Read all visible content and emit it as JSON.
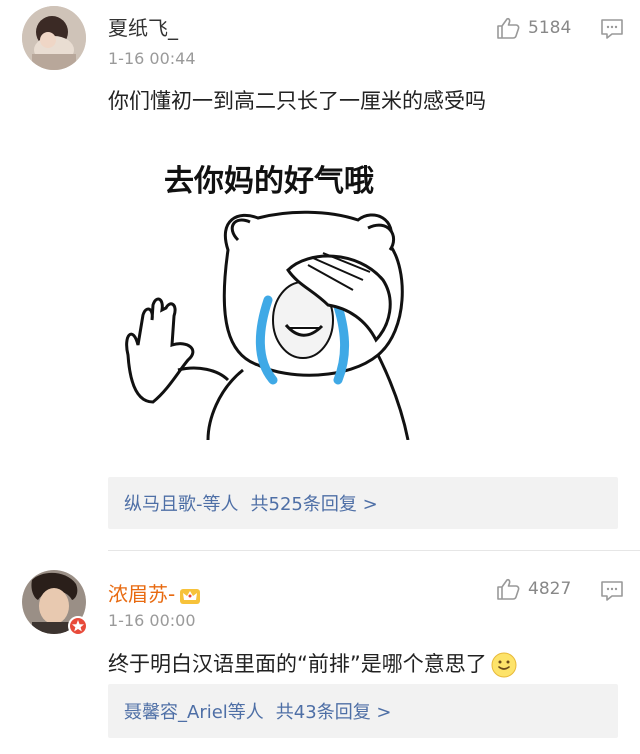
{
  "comments": [
    {
      "username": "夏纸飞_",
      "time": "1-16 00:44",
      "likes": "5184",
      "text": "你们懂初一到高二只长了一厘米的感受吗",
      "image": {
        "caption": "去你妈的好气哦"
      },
      "replies": {
        "names": "纵马且歌-等人",
        "count": "共525条回复 >"
      }
    },
    {
      "username": "浓眉苏-",
      "time": "1-16 00:00",
      "likes": "4827",
      "text": "终于明白汉语里面的“前排”是哪个意思了",
      "replies": {
        "names": "聂馨容_Ariel等人",
        "count": "共43条回复 >"
      }
    }
  ],
  "colors": {
    "link": "#4e6fa6",
    "vip_name": "#e86a10",
    "muted": "#9a9a9a",
    "tears": "#3fa9e6"
  },
  "icons": [
    "thumbs-up-icon",
    "comment-icon",
    "crown-badge-icon",
    "smile-emoji-icon",
    "verified-badge-icon"
  ]
}
